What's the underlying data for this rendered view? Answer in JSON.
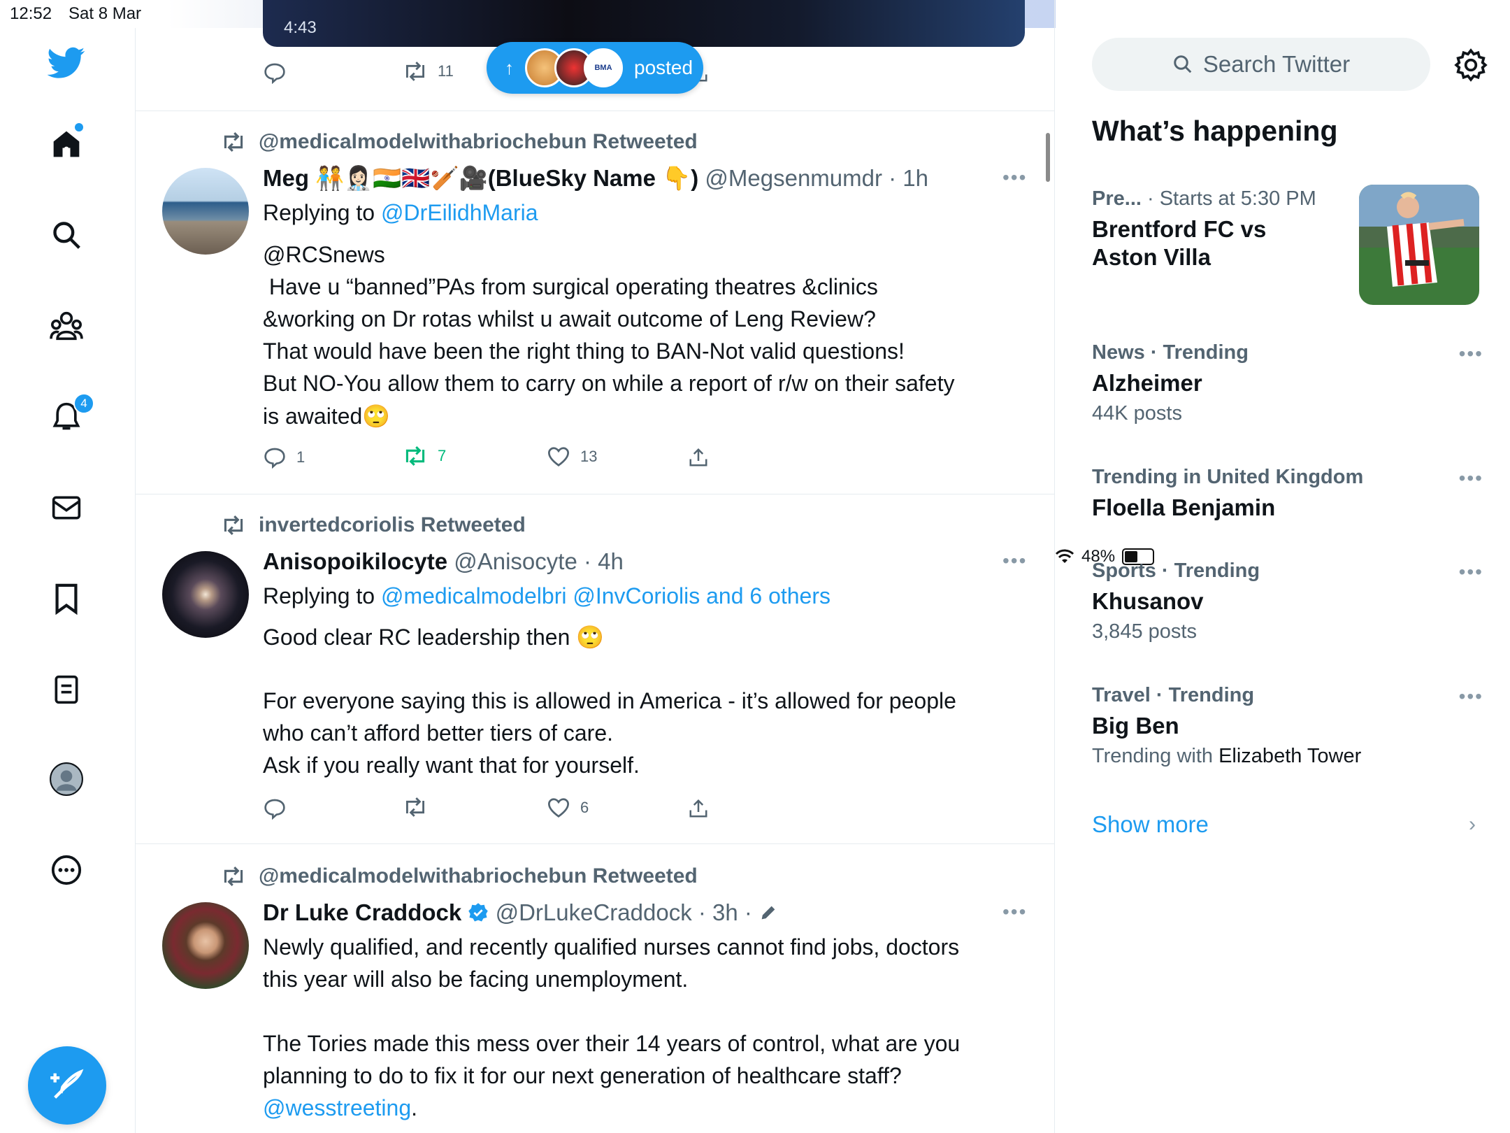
{
  "status_bar": {
    "time": "12:52",
    "date": "Sat 8 Mar",
    "battery": "48%"
  },
  "nav": {
    "notifications_badge": "4"
  },
  "feed": {
    "top_tweet": {
      "video_time": "4:43",
      "retweets": "11"
    },
    "posted_pill": {
      "label": "posted"
    },
    "tweets": [
      {
        "retweeted_by": "@medicalmodelwithabriochebun Retweeted",
        "name": "Meg 🧑‍🤝‍🧑👩🏻‍⚕️🇮🇳🇬🇧🏏🎥(BlueSky Name 👇)",
        "handle": "@Megsenmumdr",
        "time": "· 1h",
        "replying_prefix": "Replying to ",
        "replying_to": "@DrEilidhMaria",
        "mention": "@RCSnews",
        "text_lines": [
          " Have u “banned”PAs from surgical operating theatres &clinics",
          "&working on Dr rotas whilst u await outcome of Leng Review?",
          "That would have been the right thing to BAN-Not valid questions!",
          "But NO-You allow them to carry on while a report of r/w on their safety",
          "is awaited🙄"
        ],
        "replies": "1",
        "retweets": "7",
        "likes": "13"
      },
      {
        "retweeted_by": "invertedcoriolis Retweeted",
        "name": "Anisopoikilocyte",
        "handle": "@Anisocyte",
        "time": "· 4h",
        "replying_prefix": "Replying to ",
        "replying_to": "@medicalmodelbri @InvCoriolis and 6 others",
        "text_lines": [
          "Good clear RC leadership then 🙄",
          "For everyone saying this is allowed in America - it’s allowed for people",
          "who can’t afford better tiers of care.",
          "Ask if you really want that for yourself."
        ],
        "replies": "",
        "retweets": "",
        "likes": "6"
      },
      {
        "retweeted_by": "@medicalmodelwithabriochebun Retweeted",
        "name": "Dr Luke Craddock",
        "handle": "@DrLukeCraddock",
        "time": "· 3h ·",
        "text_lines": [
          "Newly qualified, and recently qualified nurses cannot find jobs, doctors",
          "this year will also be facing unemployment.",
          "The Tories made this mess over their 14 years of control, what are you",
          "planning to do to fix it for our next generation of healthcare staff?"
        ],
        "mention": "@wesstreeting",
        "mention_suffix": "."
      }
    ]
  },
  "sidebar": {
    "search_placeholder": "Search Twitter",
    "heading": "What’s happening",
    "event": {
      "category": "Pre...",
      "when": "· Starts at 5:30 PM",
      "title_line1": "Brentford FC vs",
      "title_line2": "Aston Villa"
    },
    "trends": [
      {
        "meta": "News · Trending",
        "title": "Alzheimer",
        "sub": "44K posts"
      },
      {
        "meta": "Trending in United Kingdom",
        "title": "Floella Benjamin",
        "sub": ""
      },
      {
        "meta": "Sports · Trending",
        "title": "Khusanov",
        "sub": "3,845 posts"
      },
      {
        "meta": "Travel · Trending",
        "title": "Big Ben",
        "sub_prefix": "Trending with ",
        "sub_strong": "Elizabeth Tower"
      }
    ],
    "show_more": "Show more"
  },
  "colors": {
    "accent": "#1d9bf0",
    "retweet_green": "#00ba7c",
    "text": "#0f1419",
    "muted": "#536471"
  }
}
